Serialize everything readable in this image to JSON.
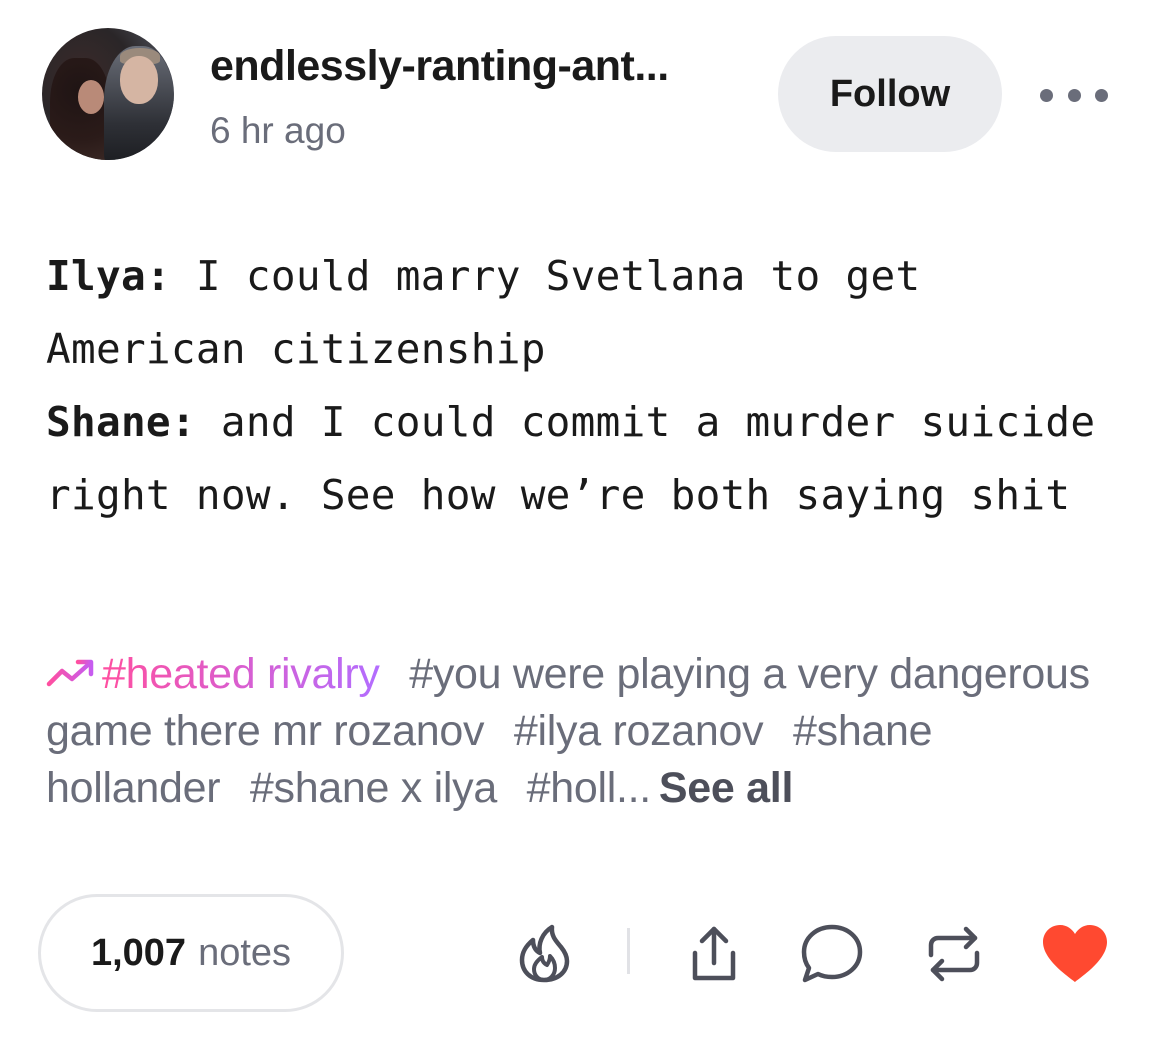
{
  "post": {
    "username": "endlessly-ranting-ant...",
    "timestamp": "6 hr ago",
    "follow_label": "Follow"
  },
  "body": {
    "lines": [
      {
        "speaker": "Ilya:",
        "text": " I could marry Svetlana to get American citizenship"
      },
      {
        "speaker": "Shane:",
        "text": " and I could commit a murder suicide right now. See how we’re both saying shit"
      }
    ]
  },
  "tags": {
    "items": [
      "#heated rivalry",
      "#you were playing a very dangerous game there mr rozanov",
      "#ilya rozanov",
      "#shane hollander",
      "#shane x ilya",
      "#holl..."
    ],
    "see_all_label": "See all"
  },
  "footer": {
    "notes_count": "1,007",
    "notes_label": "notes"
  },
  "icons": {
    "avatar": "avatar",
    "more": "more-icon",
    "trending": "trending-icon",
    "blaze": "flame-icon",
    "share": "share-icon",
    "reply": "comment-icon",
    "reblog": "reblog-icon",
    "like": "heart-icon"
  },
  "colors": {
    "like": "#ff4930",
    "tag_gradient_start": "#ff4fa0",
    "tag_gradient_end": "#b36dff",
    "muted_text": "#6a6d7a",
    "follow_bg": "#ebecef"
  }
}
